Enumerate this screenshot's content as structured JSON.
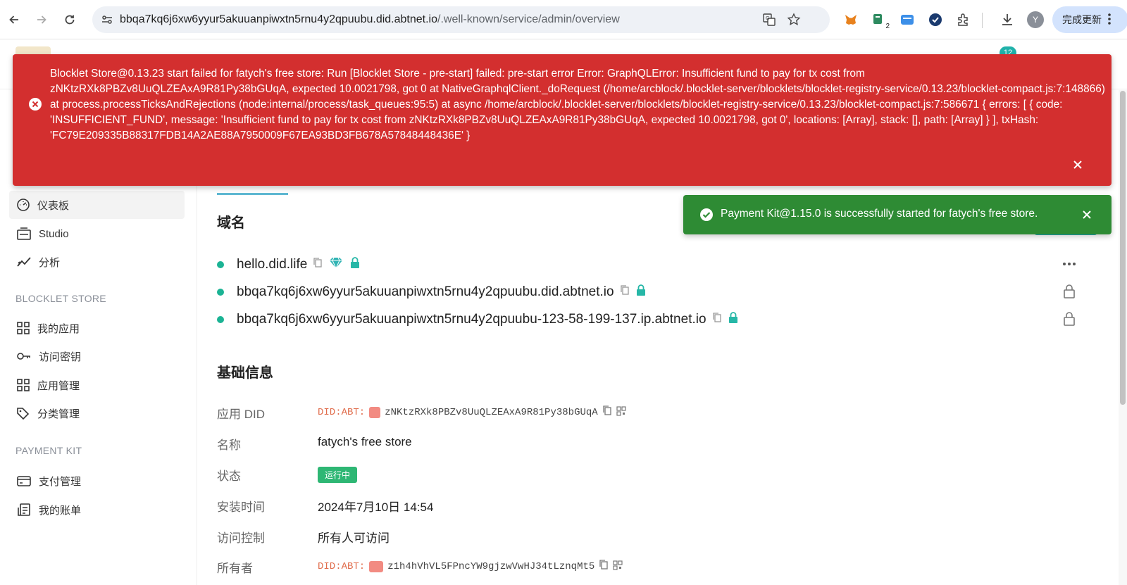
{
  "browser": {
    "url_host": "bbqa7kq6j6xw6yyur5akuuanpiwxtn5rnu4y2qpuubu.did.abtnet.io",
    "url_path": "/.well-known/service/admin/overview",
    "extension_badge": "2",
    "profile_initial": "Y",
    "update_label": "完成更新"
  },
  "header": {
    "notification_count": "12"
  },
  "sidebar": {
    "top_items": [
      {
        "label": "仪表板",
        "icon": "dashboard-icon"
      },
      {
        "label": "Studio",
        "icon": "studio-icon"
      },
      {
        "label": "分析",
        "icon": "analytics-icon"
      }
    ],
    "sections": [
      {
        "title": "BLOCKLET STORE",
        "items": [
          {
            "label": "我的应用",
            "icon": "grid-icon"
          },
          {
            "label": "访问密钥",
            "icon": "key-icon"
          },
          {
            "label": "应用管理",
            "icon": "grid-icon"
          },
          {
            "label": "分类管理",
            "icon": "tag-icon"
          }
        ]
      },
      {
        "title": "PAYMENT KIT",
        "items": [
          {
            "label": "支付管理",
            "icon": "card-icon"
          },
          {
            "label": "我的账单",
            "icon": "bill-icon"
          }
        ]
      }
    ]
  },
  "main": {
    "domain_section_title": "域名",
    "domains": [
      {
        "name": "hello.did.life"
      },
      {
        "name": "bbqa7kq6j6xw6yyur5akuuanpiwxtn5rnu4y2qpuubu.did.abtnet.io"
      },
      {
        "name": "bbqa7kq6j6xw6yyur5akuuanpiwxtn5rnu4y2qpuubu-123-58-199-137.ip.abtnet.io"
      }
    ],
    "info_section_title": "基础信息",
    "info": {
      "app_did_label": "应用 DID",
      "did_prefix": "DID:ABT:",
      "app_did": "zNKtzRXk8PBZv8UuQLZEAxA9R81Py38bGUqA",
      "name_label": "名称",
      "name_value": "fatych's free store",
      "status_label": "状态",
      "status_value": "运行中",
      "install_time_label": "安装时间",
      "install_time_value": "2024年7月10日 14:54",
      "access_label": "访问控制",
      "access_value": "所有人可访问",
      "owner_label": "所有者",
      "owner_did": "z1h4hVhVL5FPncYW9gjzwVwHJ34tLznqMt5"
    }
  },
  "error_banner": {
    "message": "Blocklet Store@0.13.23 start failed for fatych's free store: Run [Blocklet Store - pre-start] failed: pre-start error Error: GraphQLError: Insufficient fund to pay for tx cost from zNKtzRXk8PBZv8UuQLZEAxA9R81Py38bGUqA, expected 10.0021798, got 0 at NativeGraphqlClient._doRequest (/home/arcblock/.blocklet-server/blocklets/blocklet-registry-service/0.13.23/blocklet-compact.js:7:148866) at process.processTicksAndRejections (node:internal/process/task_queues:95:5) at async /home/arcblock/.blocklet-server/blocklets/blocklet-registry-service/0.13.23/blocklet-compact.js:7:586671 { errors: [ { code: 'INSUFFICIENT_FUND', message: 'Insufficient fund to pay for tx cost from zNKtzRXk8PBZv8UuQLZEAxA9R81Py38bGUqA, expected 10.0021798, got 0', locations: [Array], stack: [], path: [Array] } ], txHash: 'FC79E209335B88317FDB14A2AE88A7950009F67EA93BD3FB678A57848448436E' }"
  },
  "toast": {
    "message": "Payment Kit@1.15.0 is successfully started for fatych's free store."
  },
  "colors": {
    "error": "#d32f2f",
    "success": "#2e8b34",
    "accent": "#1bb394"
  }
}
